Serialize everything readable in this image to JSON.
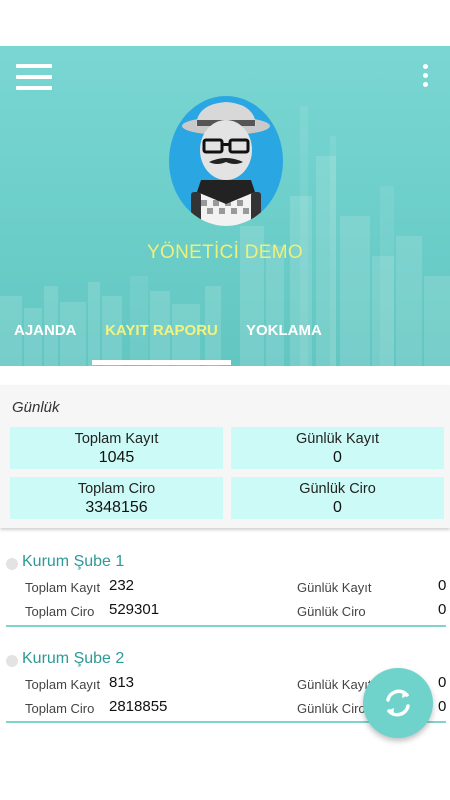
{
  "header": {
    "user_name": "YÖNETİCİ DEMO",
    "tabs": [
      {
        "label": "AJANDA"
      },
      {
        "label": "KAYIT RAPORU"
      },
      {
        "label": "YOKLAMA"
      }
    ],
    "active_tab": "KAYIT RAPORU"
  },
  "icons": {
    "menu": "hamburger-menu-icon",
    "more": "vertical-dots-icon",
    "fab": "refresh-icon"
  },
  "daily": {
    "title": "Günlük",
    "stats": [
      {
        "label": "Toplam Kayıt",
        "value": "1045"
      },
      {
        "label": "Günlük Kayıt",
        "value": "0"
      },
      {
        "label": "Toplam Ciro",
        "value": "3348156"
      },
      {
        "label": "Günlük Ciro",
        "value": "0"
      }
    ]
  },
  "branches": [
    {
      "name": "Kurum Şube 1",
      "toplam_kayit_label": "Toplam Kayıt",
      "toplam_kayit": "232",
      "toplam_ciro_label": "Toplam Ciro",
      "toplam_ciro": "529301",
      "gunluk_kayit_label": "Günlük Kayıt",
      "gunluk_kayit": "0",
      "gunluk_ciro_label": "Günlük Ciro",
      "gunluk_ciro": "0"
    },
    {
      "name": "Kurum Şube 2",
      "toplam_kayit_label": "Toplam Kayıt",
      "toplam_kayit": "813",
      "toplam_ciro_label": "Toplam Ciro",
      "toplam_ciro": "2818855",
      "gunluk_kayit_label": "Günlük Kayıt",
      "gunluk_kayit": "0",
      "gunluk_ciro_label": "Günlük Ciro",
      "gunluk_ciro": "0"
    }
  ],
  "colors": {
    "accent": "#6fd0cb",
    "stat_bg": "#ccfaf6",
    "branch_title": "#2c9a96",
    "active_tab": "#f4f27e"
  }
}
